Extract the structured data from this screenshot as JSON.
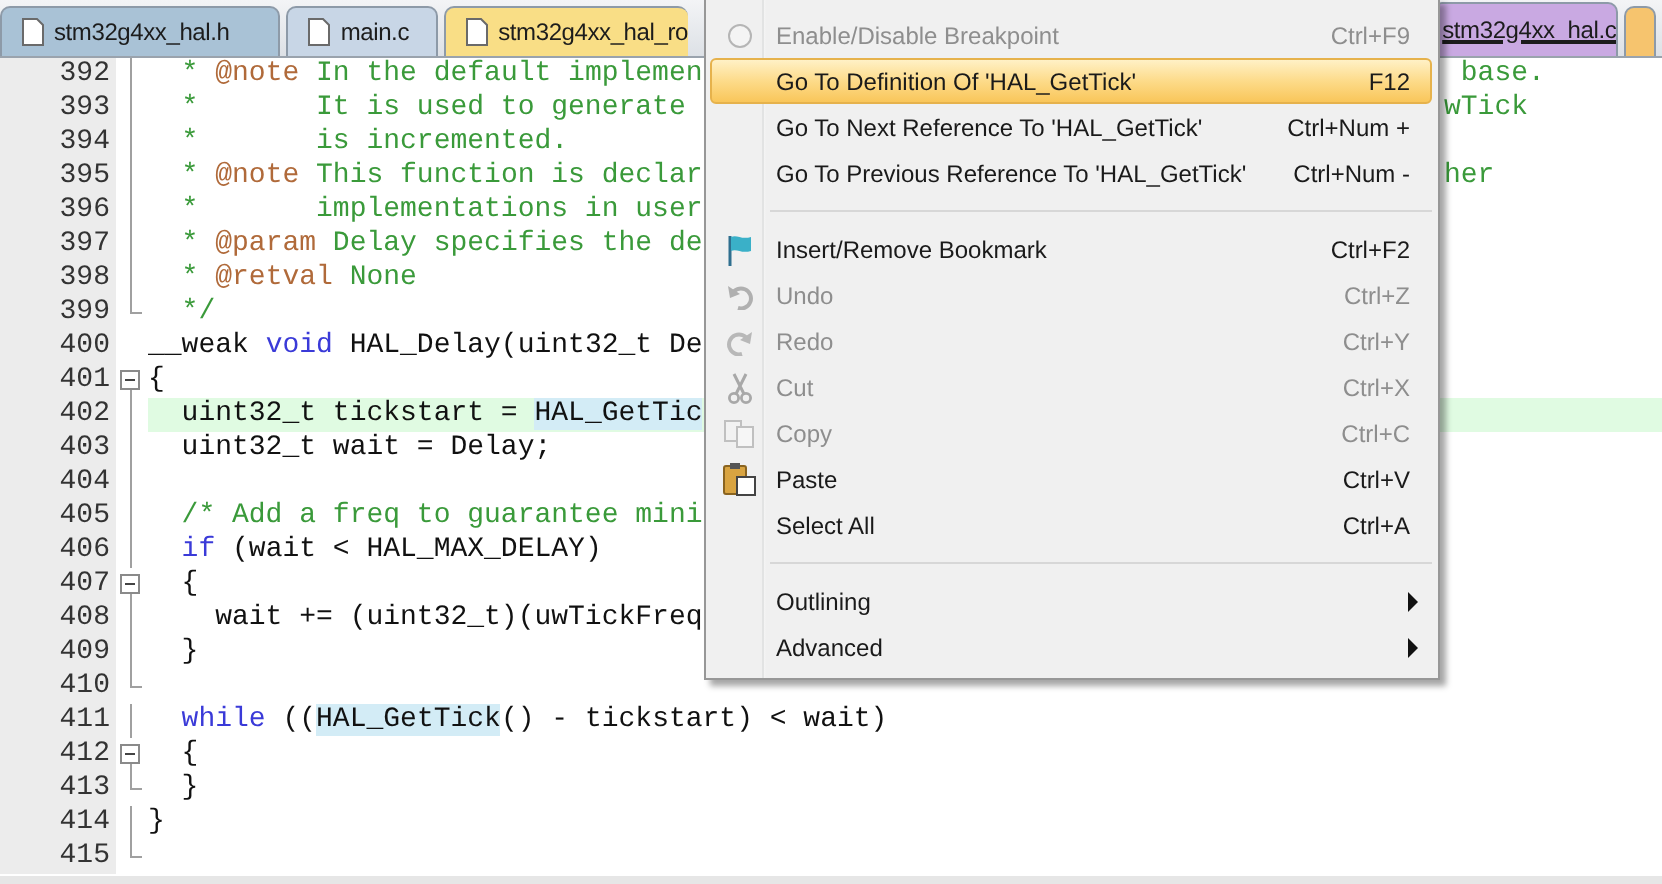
{
  "tabs": [
    {
      "label": "stm32g4xx_hal.h",
      "color": "#a9c2d6",
      "selected": false
    },
    {
      "label": "main.c",
      "color": "#c8d6e6",
      "selected": false
    },
    {
      "label": "stm32g4xx_hal_ro",
      "color": "#f9de86",
      "selected": false
    },
    {
      "label": "stm32g4xx_hal.c",
      "color": "#c9a9e2",
      "selected": true
    },
    {
      "color": "#f6c46e",
      "selected": false
    }
  ],
  "editor": {
    "lines": [
      {
        "number": "392",
        "kind": "bar",
        "current": false,
        "segments": [
          {
            "text": "  * ",
            "kind": "comment"
          },
          {
            "text": "@note",
            "kind": "doctag"
          },
          {
            "text": " In the default implemen",
            "kind": "comment"
          }
        ],
        "right": " base."
      },
      {
        "number": "393",
        "kind": "bar",
        "current": false,
        "segments": [
          {
            "text": "  *       It is used to generate",
            "kind": "comment"
          }
        ],
        "right": "wTick"
      },
      {
        "number": "394",
        "kind": "bar",
        "current": false,
        "segments": [
          {
            "text": "  *       is incremented.",
            "kind": "comment"
          }
        ]
      },
      {
        "number": "395",
        "kind": "bar",
        "current": false,
        "segments": [
          {
            "text": "  * ",
            "kind": "comment"
          },
          {
            "text": "@note",
            "kind": "doctag"
          },
          {
            "text": " This function is declar",
            "kind": "comment"
          }
        ],
        "right": "her"
      },
      {
        "number": "396",
        "kind": "bar",
        "current": false,
        "segments": [
          {
            "text": "  *       implementations in user",
            "kind": "comment"
          }
        ]
      },
      {
        "number": "397",
        "kind": "bar",
        "current": false,
        "segments": [
          {
            "text": "  * ",
            "kind": "comment"
          },
          {
            "text": "@param",
            "kind": "doctag"
          },
          {
            "text": " Delay specifies the de",
            "kind": "comment"
          }
        ]
      },
      {
        "number": "398",
        "kind": "bar",
        "current": false,
        "segments": [
          {
            "text": "  * ",
            "kind": "comment"
          },
          {
            "text": "@retval",
            "kind": "doctag"
          },
          {
            "text": " None",
            "kind": "comment"
          }
        ]
      },
      {
        "number": "399",
        "kind": "end",
        "current": false,
        "segments": [
          {
            "text": "  */",
            "kind": "comment"
          }
        ]
      },
      {
        "number": "400",
        "kind": "none",
        "current": false,
        "segments": [
          {
            "text": "__weak ",
            "kind": "plain"
          },
          {
            "text": "void",
            "kind": "keyword"
          },
          {
            "text": " HAL_Delay(uint32_t De",
            "kind": "plain"
          }
        ]
      },
      {
        "number": "401",
        "kind": "box",
        "current": false,
        "segments": [
          {
            "text": "{",
            "kind": "plain"
          }
        ]
      },
      {
        "number": "402",
        "kind": "bar",
        "current": true,
        "segments": [
          {
            "text": "  uint32_t tickstart = ",
            "kind": "plain"
          },
          {
            "text": "HAL_GetTic",
            "kind": "match"
          }
        ]
      },
      {
        "number": "403",
        "kind": "bar",
        "current": false,
        "segments": [
          {
            "text": "  uint32_t wait = Delay;",
            "kind": "plain"
          }
        ]
      },
      {
        "number": "404",
        "kind": "bar",
        "current": false
      },
      {
        "number": "405",
        "kind": "bar",
        "current": false,
        "segments": [
          {
            "text": "  /* Add a freq to guarantee mini",
            "kind": "comment"
          }
        ]
      },
      {
        "number": "406",
        "kind": "bar",
        "current": false,
        "segments": [
          {
            "text": "  if",
            "kind": "keyword"
          },
          {
            "text": " (wait < HAL_MAX_DELAY)",
            "kind": "plain"
          }
        ]
      },
      {
        "number": "407",
        "kind": "box",
        "current": false,
        "segments": [
          {
            "text": "  {",
            "kind": "plain"
          }
        ]
      },
      {
        "number": "408",
        "kind": "bar",
        "current": false,
        "segments": [
          {
            "text": "    wait += (uint32_t)(uwTickFreq",
            "kind": "plain"
          }
        ]
      },
      {
        "number": "409",
        "kind": "bar",
        "current": false,
        "segments": [
          {
            "text": "  }",
            "kind": "plain"
          }
        ]
      },
      {
        "number": "410",
        "kind": "end",
        "current": false
      },
      {
        "number": "411",
        "kind": "bar",
        "current": false,
        "segments": [
          {
            "text": "  while",
            "kind": "keyword"
          },
          {
            "text": " ((",
            "kind": "plain"
          },
          {
            "text": "HAL_GetTick",
            "kind": "match"
          },
          {
            "text": "() - tickstart) < wait)",
            "kind": "plain"
          }
        ]
      },
      {
        "number": "412",
        "kind": "box",
        "current": false,
        "segments": [
          {
            "text": "  {",
            "kind": "plain"
          }
        ]
      },
      {
        "number": "413",
        "kind": "end",
        "current": false,
        "segments": [
          {
            "text": "  }",
            "kind": "plain"
          }
        ]
      },
      {
        "number": "414",
        "kind": "bar",
        "current": false,
        "segments": [
          {
            "text": "}",
            "kind": "plain"
          }
        ]
      },
      {
        "number": "415",
        "kind": "end",
        "current": false
      }
    ]
  },
  "context_menu": {
    "items": [
      {
        "kind": "item",
        "label": "Enable/Disable Breakpoint",
        "shortcut": "Ctrl+F9",
        "disabled": true,
        "highlighted": false
      },
      {
        "kind": "item",
        "label": "Go To Definition Of 'HAL_GetTick'",
        "shortcut": "F12",
        "disabled": false,
        "highlighted": true
      },
      {
        "kind": "item",
        "label": "Go To Next Reference To 'HAL_GetTick'",
        "shortcut": "Ctrl+Num +",
        "disabled": false,
        "highlighted": false
      },
      {
        "kind": "item",
        "label": "Go To Previous Reference To 'HAL_GetTick'",
        "shortcut": "Ctrl+Num -",
        "disabled": false,
        "highlighted": false
      },
      {
        "kind": "separator"
      },
      {
        "kind": "item",
        "label": "Insert/Remove Bookmark",
        "shortcut": "Ctrl+F2",
        "disabled": false,
        "highlighted": false
      },
      {
        "kind": "item",
        "label": "Undo",
        "shortcut": "Ctrl+Z",
        "disabled": true,
        "highlighted": false
      },
      {
        "kind": "item",
        "label": "Redo",
        "shortcut": "Ctrl+Y",
        "disabled": true,
        "highlighted": false
      },
      {
        "kind": "item",
        "label": "Cut",
        "shortcut": "Ctrl+X",
        "disabled": true,
        "highlighted": false
      },
      {
        "kind": "item",
        "label": "Copy",
        "shortcut": "Ctrl+C",
        "disabled": true,
        "highlighted": false
      },
      {
        "kind": "item",
        "label": "Paste",
        "shortcut": "Ctrl+V",
        "disabled": false,
        "highlighted": false
      },
      {
        "kind": "item",
        "label": "Select All",
        "shortcut": "Ctrl+A",
        "disabled": false,
        "highlighted": false
      },
      {
        "kind": "separator"
      },
      {
        "kind": "submenu",
        "label": "Outlining",
        "disabled": false,
        "highlighted": false
      },
      {
        "kind": "submenu",
        "label": "Advanced",
        "disabled": false,
        "highlighted": false
      }
    ]
  }
}
